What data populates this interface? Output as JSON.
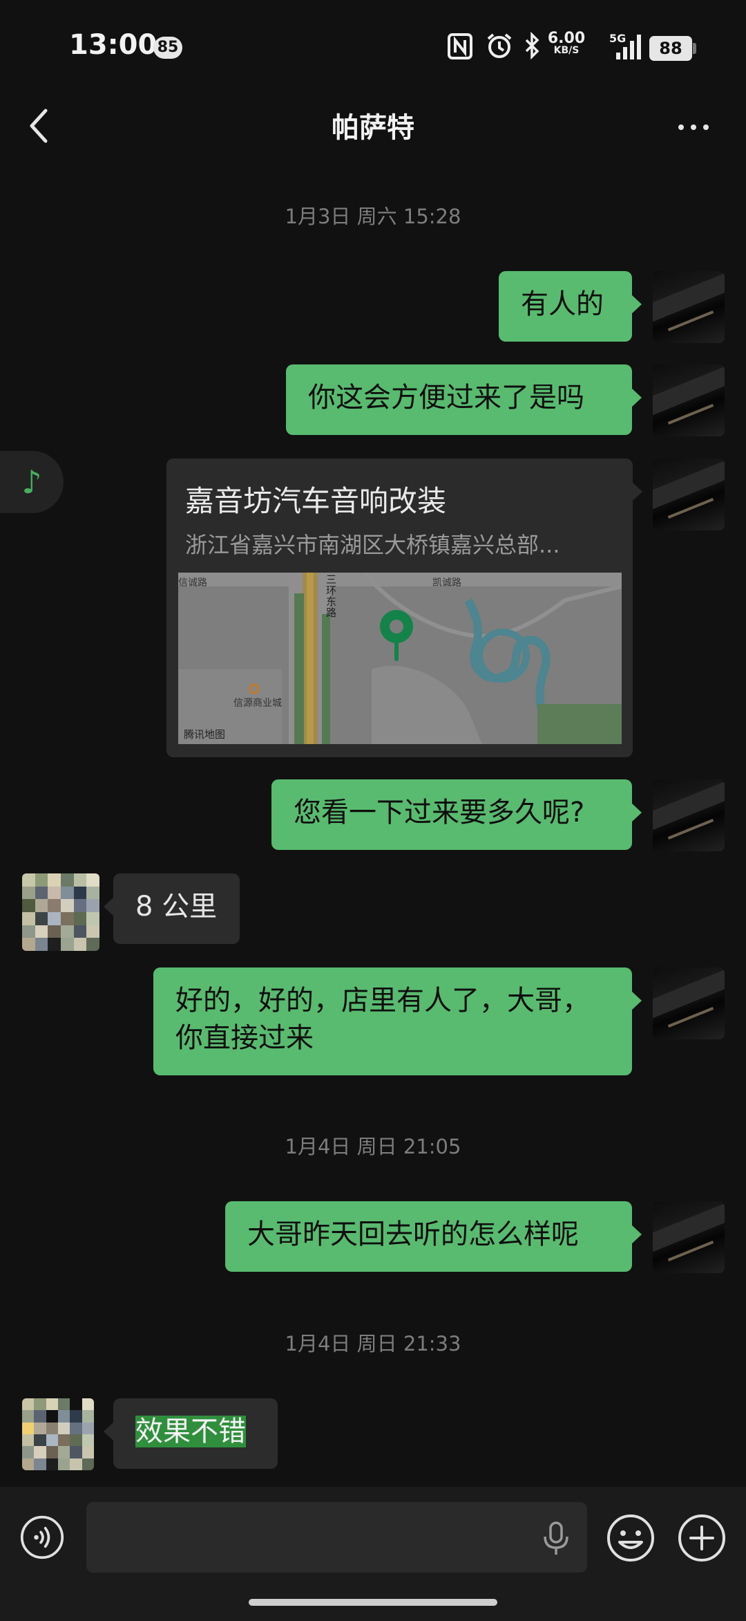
{
  "status_bar": {
    "time": "13:00",
    "notification_count": "85",
    "net_speed_value": "6.00",
    "net_speed_unit": "KB/S",
    "network_type": "5G",
    "battery": "88"
  },
  "header": {
    "title": "帕萨特"
  },
  "messages": {
    "ts1": "1月3日 周六 15:28",
    "m1": "有人的",
    "m2": "你这会方便过来了是吗",
    "location": {
      "name": "嘉音坊汽车音响改装",
      "address": "浙江省嘉兴市南湖区大桥镇嘉兴总部...",
      "map_credit": "腾讯地图",
      "map_road_vertical": "三环东路",
      "map_road_left": "信诚路",
      "map_road_right": "凯诚路",
      "map_poi": "信源商业城"
    },
    "m3": "您看一下过来要多久呢?",
    "m4": "8 公里",
    "m5_line1": "好的，好的，店里有人了，大哥，",
    "m5_line2": "你直接过来",
    "ts2": "1月4日 周日 21:05",
    "m6": "大哥昨天回去听的怎么样呢",
    "ts3": "1月4日 周日 21:33",
    "m7": "效果不错"
  },
  "colors": {
    "background": "#111111",
    "outgoing_bubble": "#58bb6f",
    "incoming_bubble": "#2c2c2c",
    "accent_green": "#47b05e"
  },
  "icons": [
    "back-arrow-icon",
    "more-icon",
    "nfc-icon",
    "alarm-icon",
    "bluetooth-icon",
    "signal-icon",
    "battery-icon",
    "music-note-icon",
    "location-pin-icon",
    "voice-icon",
    "microphone-icon",
    "emoji-icon",
    "plus-icon"
  ]
}
